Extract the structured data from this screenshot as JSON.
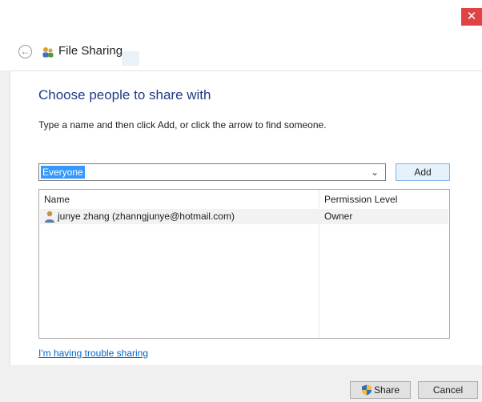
{
  "window": {
    "close_label": "✕"
  },
  "nav": {
    "back_label": "←",
    "title": "File Sharing"
  },
  "main": {
    "heading": "Choose people to share with",
    "instructions": "Type a name and then click Add, or click the arrow to find someone.",
    "combo_value": "Everyone",
    "combo_arrow": "⌄",
    "add_label": "Add"
  },
  "table": {
    "columns": [
      "Name",
      "Permission Level"
    ],
    "rows": [
      {
        "name": "junye zhang (zhanngjunye@hotmail.com)",
        "permission": "Owner"
      }
    ]
  },
  "trouble_link": "I'm having trouble sharing",
  "footer": {
    "share_label": "Share",
    "cancel_label": "Cancel"
  },
  "colors": {
    "heading": "#1f3b88",
    "link": "#0066cc",
    "selection": "#3399ff",
    "close": "#e04343"
  }
}
